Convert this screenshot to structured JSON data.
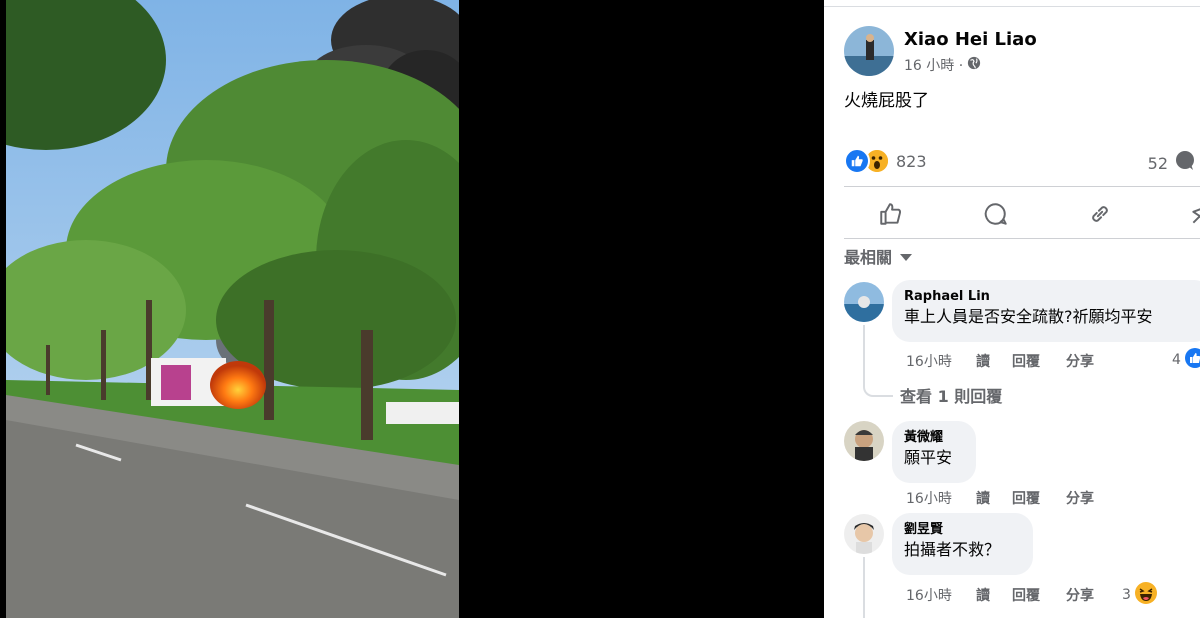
{
  "post": {
    "author": "Xiao Hei Liao",
    "time": "16 小時 ·",
    "privacy_icon": "globe-icon",
    "text": "火燒屁股了",
    "reaction_count": "823",
    "comment_count": "52",
    "reaction_icons": [
      "like-icon",
      "wow-icon"
    ]
  },
  "actions": [
    "like-icon",
    "comment-icon",
    "share-link-icon",
    "send-icon"
  ],
  "sort_label": "最相關",
  "view_replies": "查看 1 則回覆",
  "comments": [
    {
      "author": "Raphael Lin",
      "text": "車上人員是否安全疏散?祈願均平安",
      "time": "16小時",
      "read": "讀",
      "reply": "回覆",
      "share": "分享",
      "reactions": "4"
    },
    {
      "author": "黃微耀",
      "text": "願平安",
      "time": "16小時",
      "read": "讀",
      "reply": "回覆",
      "share": "分享"
    },
    {
      "author": "劉昱賢",
      "text": "拍攝者不救？",
      "time": "16小時",
      "read": "讀",
      "reply": "回覆",
      "share": "分享",
      "reactions": "3"
    }
  ],
  "colors": {
    "accent": "#1877f2",
    "bubble": "#f0f2f5",
    "muted": "#65676b"
  }
}
